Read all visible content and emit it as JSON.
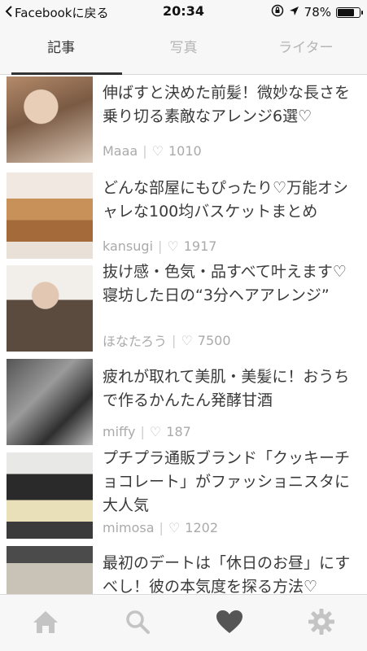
{
  "status_bar": {
    "back_label": "Facebookに戻る",
    "time": "20:34",
    "battery": "78%",
    "battery_level": 0.78
  },
  "tabs": [
    {
      "label": "記事",
      "active": true
    },
    {
      "label": "写真",
      "active": false
    },
    {
      "label": "ライター",
      "active": false
    }
  ],
  "articles": [
    {
      "title": "伸ばすと決めた前髪！微妙な長さを乗り切る素敵なアレンジ6選♡",
      "author": "Maaa",
      "likes": "1010"
    },
    {
      "title": "どんな部屋にもぴったり♡万能オシャレな100均バスケットまとめ",
      "author": "kansugi",
      "likes": "1917"
    },
    {
      "title": "抜け感・色気・品すべて叶えます♡寝坊した日の“3分ヘアアレンジ”",
      "author": "ほなたろう",
      "likes": "7500"
    },
    {
      "title": "疲れが取れて美肌・美髪に！おうちで作るかんたん発酵甘酒",
      "author": "miffy",
      "likes": "187"
    },
    {
      "title": "プチプラ通販ブランド「クッキーチョコレート」がファッショニスタに大人気",
      "author": "mimosa",
      "likes": "1202"
    },
    {
      "title": "最初のデートは「休日のお昼」にすべし！彼の本気度を探る方法♡",
      "author": "",
      "likes": ""
    }
  ],
  "bottom_nav": [
    {
      "icon": "home-icon"
    },
    {
      "icon": "search-icon"
    },
    {
      "icon": "heart-icon",
      "active": true
    },
    {
      "icon": "gear-icon"
    }
  ],
  "colors": {
    "active": "#555555",
    "inactive": "#c4c4c4",
    "text": "#3a3a3a",
    "meta": "#aaaaaa"
  }
}
